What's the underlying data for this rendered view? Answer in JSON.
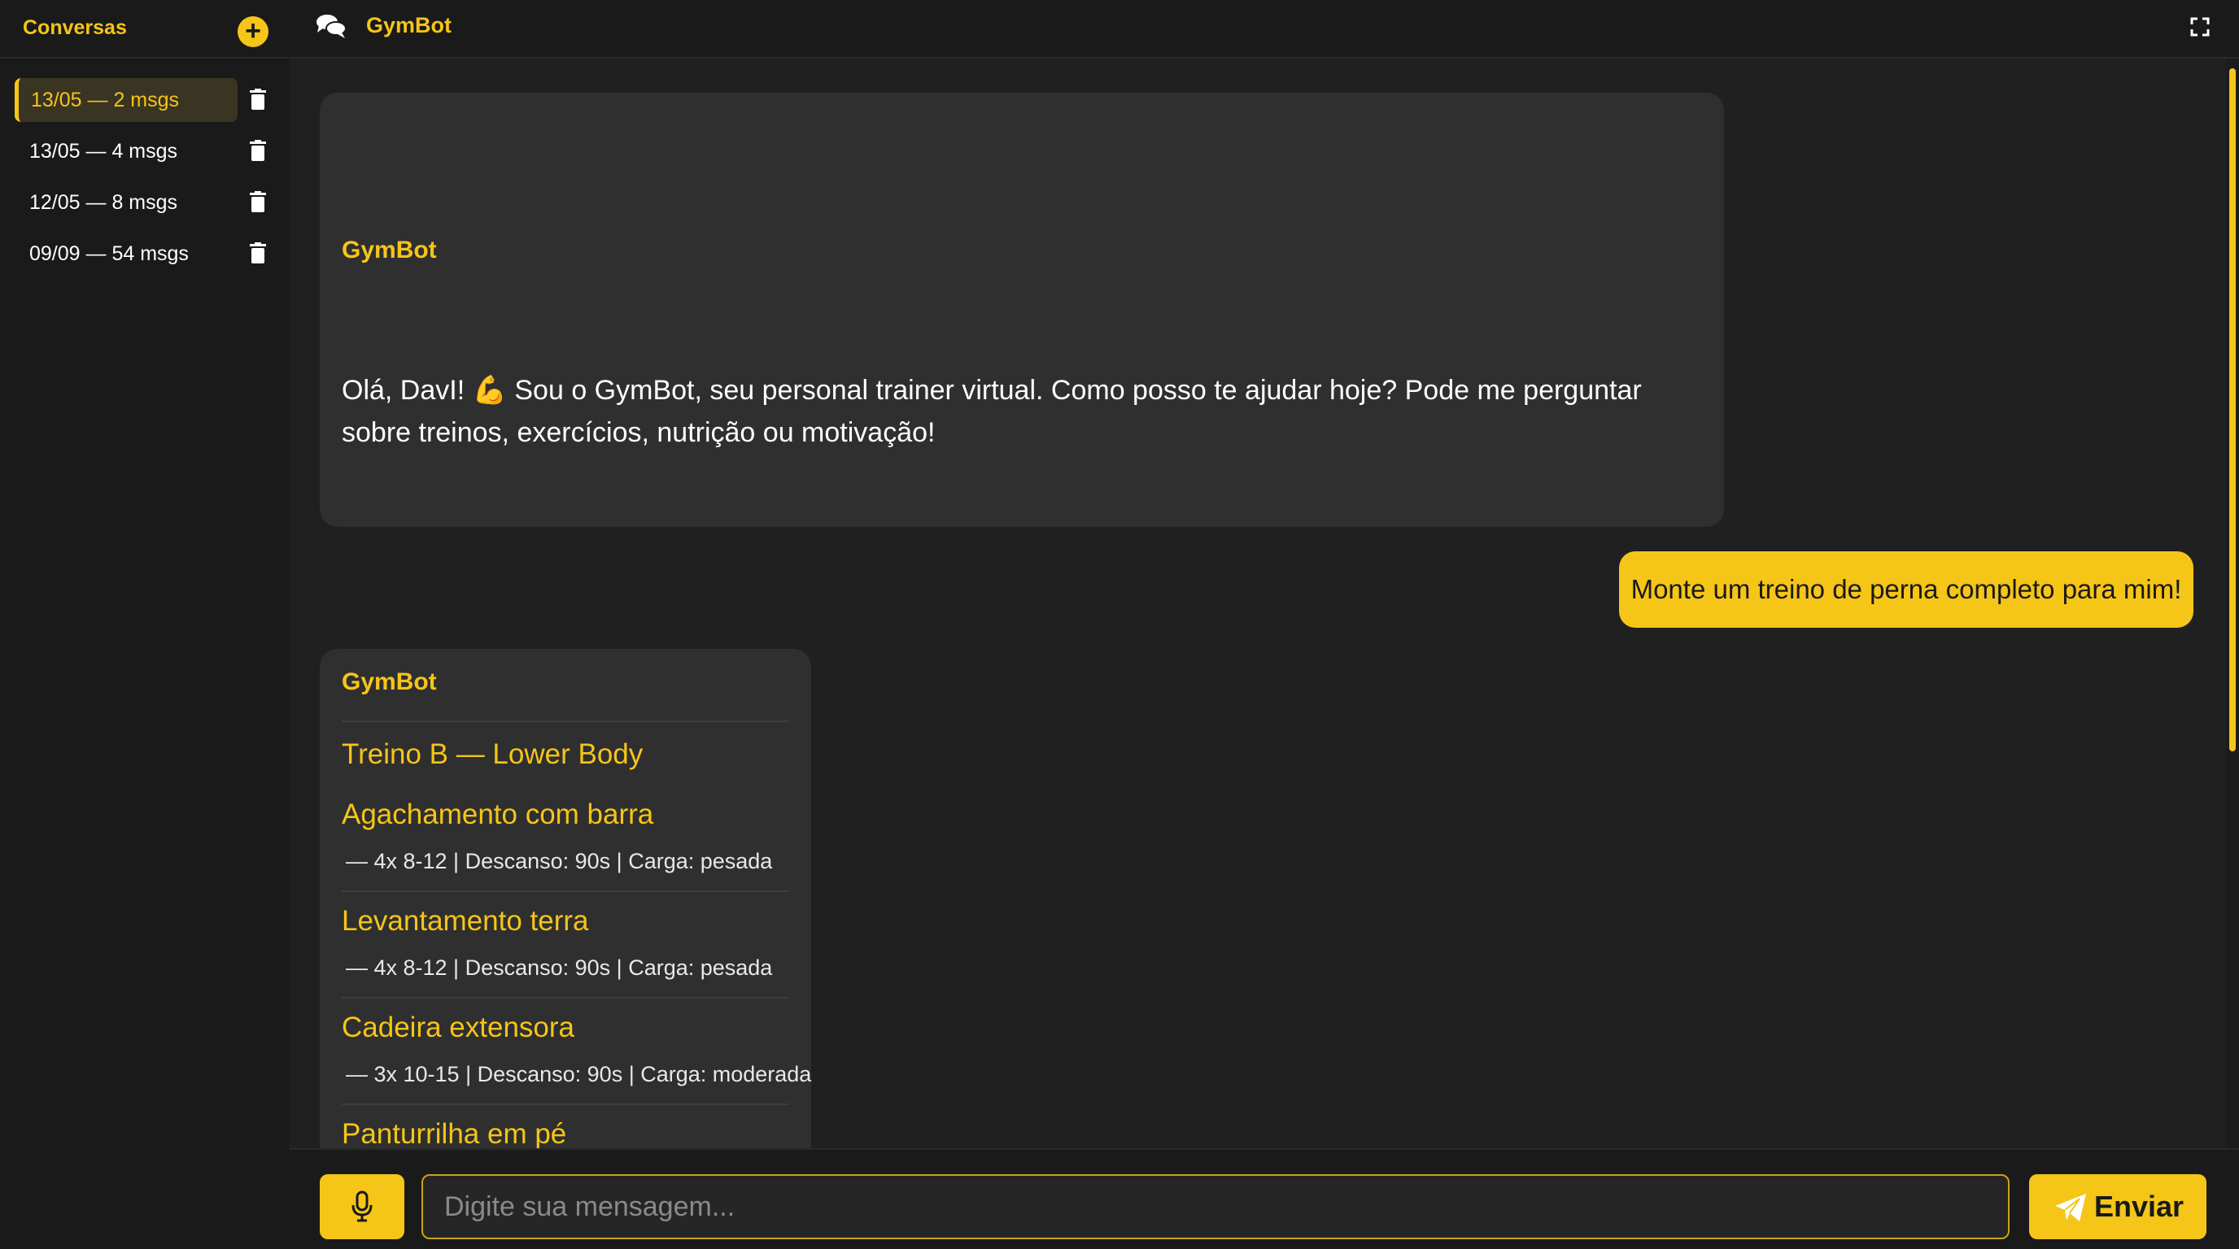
{
  "sidebar": {
    "title": "Conversas",
    "new_button_label": "+",
    "conversations": [
      {
        "label": "13/05 — 2 msgs",
        "active": true
      },
      {
        "label": "13/05 — 4 msgs",
        "active": false
      },
      {
        "label": "12/05 — 8 msgs",
        "active": false
      },
      {
        "label": "09/09 — 54 msgs",
        "active": false
      }
    ]
  },
  "header": {
    "title": "GymBot"
  },
  "messages": {
    "greeting": {
      "sender": "GymBot",
      "text": "Olá, DavI! 💪 Sou o GymBot, seu personal trainer virtual. Como posso te ajudar hoje? Pode me perguntar sobre treinos, exercícios, nutrição ou motivação!"
    },
    "user": {
      "text": "Monte um treino de perna completo para mim!"
    },
    "plan": {
      "sender": "GymBot",
      "title": "Treino B — Lower Body",
      "exercises": [
        {
          "name": "Agachamento com barra",
          "detail": "— 4x 8-12 | Descanso: 90s | Carga: pesada"
        },
        {
          "name": "Levantamento terra",
          "detail": "— 4x 8-12 | Descanso: 90s | Carga: pesada"
        },
        {
          "name": "Cadeira extensora",
          "detail": "— 3x 10-15 | Descanso: 90s | Carga: moderada"
        },
        {
          "name": "Panturrilha em pé",
          "detail": ""
        }
      ]
    }
  },
  "input": {
    "placeholder": "Digite sua mensagem...",
    "value": ""
  },
  "send_button": {
    "label": "Enviar"
  },
  "colors": {
    "accent": "#f5c518",
    "background": "#1f1f1f",
    "bubble": "#2f2f2f"
  },
  "icons": [
    "add-icon",
    "trash-icon",
    "chat-icon",
    "expand-icon",
    "microphone-icon",
    "send-icon"
  ]
}
